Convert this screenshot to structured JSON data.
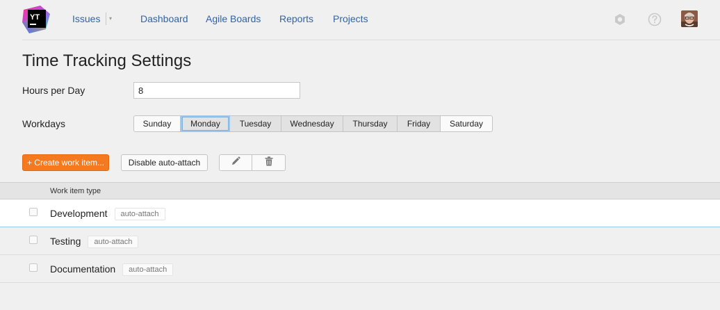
{
  "nav": {
    "issues": "Issues",
    "dashboard": "Dashboard",
    "agile_boards": "Agile Boards",
    "reports": "Reports",
    "projects": "Projects",
    "caret": "▾"
  },
  "logo": {
    "text": "YT"
  },
  "page": {
    "title": "Time Tracking Settings"
  },
  "form": {
    "hours_label": "Hours per Day",
    "hours_value": "8",
    "workdays_label": "Workdays"
  },
  "workdays": [
    {
      "label": "Sunday",
      "selected": false
    },
    {
      "label": "Monday",
      "selected": true
    },
    {
      "label": "Tuesday",
      "selected": true
    },
    {
      "label": "Wednesday",
      "selected": true
    },
    {
      "label": "Thursday",
      "selected": true
    },
    {
      "label": "Friday",
      "selected": true
    },
    {
      "label": "Saturday",
      "selected": false
    }
  ],
  "toolbar": {
    "create_label": "+ Create work item...",
    "disable_label": "Disable auto-attach"
  },
  "table": {
    "column_header": "Work item type",
    "rows": [
      {
        "name": "Development",
        "tag": "auto-attach"
      },
      {
        "name": "Testing",
        "tag": "auto-attach"
      },
      {
        "name": "Documentation",
        "tag": "auto-attach"
      }
    ]
  },
  "colors": {
    "accent": "#f5791f",
    "link": "#2f63a8",
    "focus": "#9cc7ea"
  },
  "icons": [
    "youtrack-logo",
    "gear-icon",
    "help-icon",
    "user-avatar",
    "pencil-icon",
    "trash-icon"
  ]
}
